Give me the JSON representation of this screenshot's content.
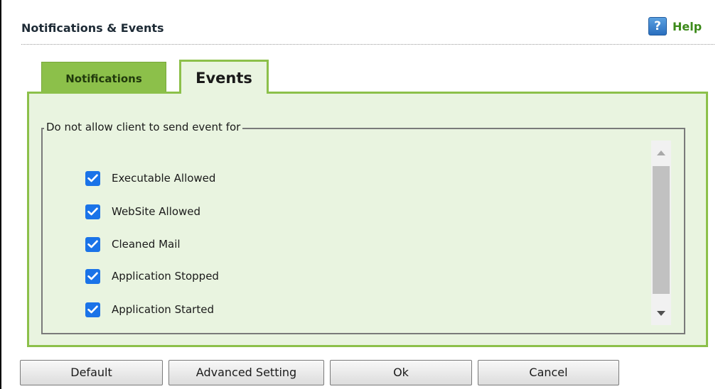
{
  "header": {
    "title": "Notifications & Events",
    "help_label": "Help",
    "help_icon": "question-mark-icon"
  },
  "tabs": [
    {
      "label": "Notifications",
      "active": false
    },
    {
      "label": "Events",
      "active": true
    }
  ],
  "panel": {
    "legend": "Do not allow client to send event for",
    "items": [
      {
        "label": "Executable Allowed",
        "checked": true
      },
      {
        "label": "WebSite Allowed",
        "checked": true
      },
      {
        "label": "Cleaned Mail",
        "checked": true
      },
      {
        "label": "Application Stopped",
        "checked": true
      },
      {
        "label": "Application Started",
        "checked": true
      }
    ]
  },
  "buttons": {
    "default": "Default",
    "advanced": "Advanced Setting",
    "ok": "Ok",
    "cancel": "Cancel"
  },
  "colors": {
    "accent_green": "#8cc04a",
    "panel_bg": "#e9f4e0",
    "checkbox_blue": "#1a73e8",
    "help_green": "#3c8a1a"
  }
}
